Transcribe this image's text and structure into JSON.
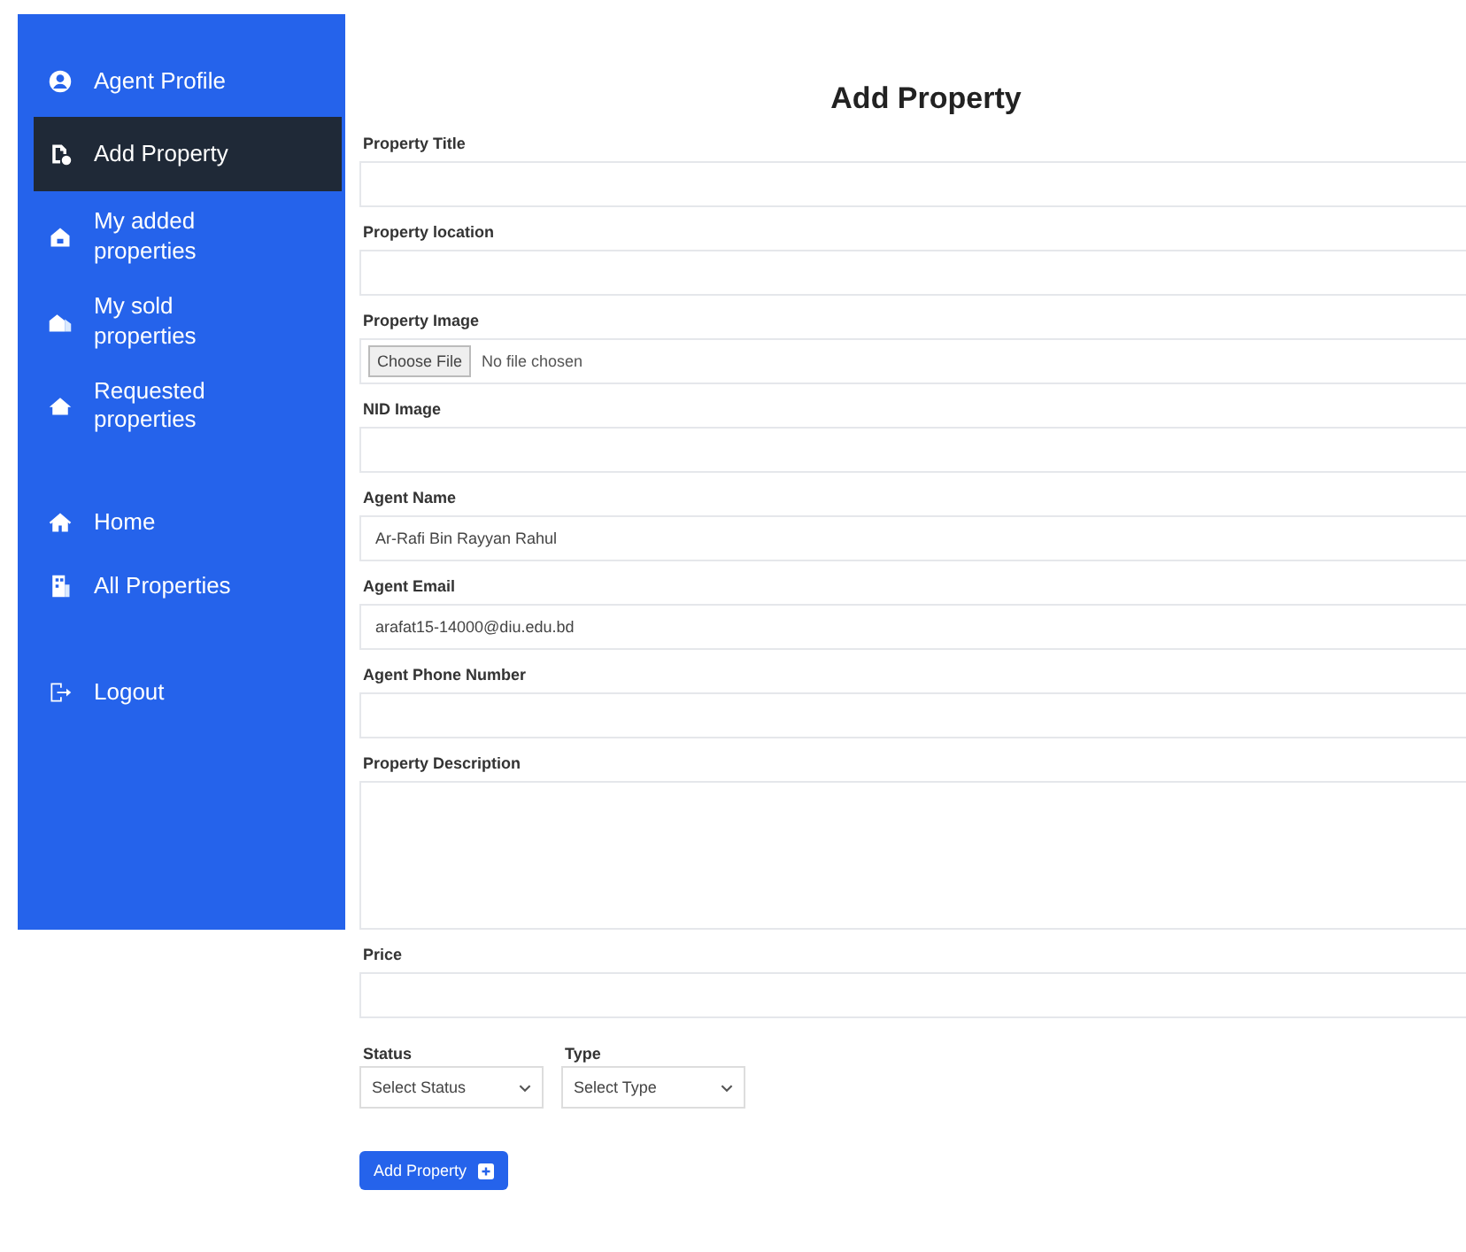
{
  "sidebar": {
    "items": [
      {
        "label": "Agent Profile",
        "kind": "user",
        "selected": false
      },
      {
        "label": "Add Property",
        "kind": "file",
        "selected": true
      },
      {
        "label": "My added properties",
        "kind": "house",
        "selected": false
      },
      {
        "label": "My sold properties",
        "kind": "houses",
        "selected": false
      },
      {
        "label": "Requested properties",
        "kind": "roof",
        "selected": false
      }
    ],
    "links": [
      {
        "label": "Home",
        "kind": "home"
      },
      {
        "label": "All Properties",
        "kind": "building"
      }
    ],
    "logout": {
      "label": "Logout"
    }
  },
  "form": {
    "title": "Add Property",
    "fields": [
      {
        "kind": "text",
        "label": "Property Title"
      },
      {
        "kind": "text",
        "label": "Property location"
      },
      {
        "kind": "file",
        "label": "Property Image",
        "button": "Choose File",
        "status": "No file chosen"
      },
      {
        "kind": "text",
        "label": "NID Image"
      },
      {
        "kind": "text",
        "label": "Agent Name",
        "value": "Ar-Rafi Bin Rayyan Rahul"
      },
      {
        "kind": "text",
        "label": "Agent Email",
        "value": "arafat15-14000@diu.edu.bd"
      },
      {
        "kind": "text",
        "label": "Agent Phone Number"
      },
      {
        "kind": "textarea",
        "label": "Property Description"
      },
      {
        "kind": "text",
        "label": "Price"
      }
    ],
    "selects": [
      {
        "label": "Status",
        "value": "Select Status"
      },
      {
        "label": "Type",
        "value": "Select Type"
      }
    ],
    "submit": {
      "label": "Add Property"
    }
  }
}
